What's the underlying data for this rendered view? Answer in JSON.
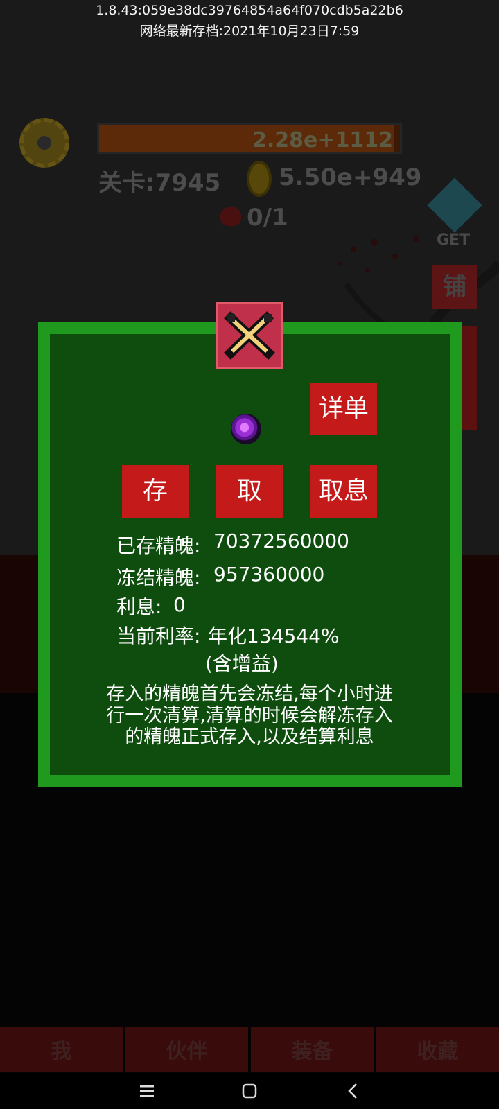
{
  "top": {
    "version": "1.8.43:059e38dc39764854a64f070cdb5a22b6",
    "save_time": "网络最新存档:2021年10月23日7:59"
  },
  "hud": {
    "hp_value": "2.28e+1112",
    "stage": "关卡:7945",
    "gold": "5.50e+949",
    "kills": "0/1",
    "get_label": "GET",
    "shop_label": "铺"
  },
  "dialog": {
    "details_button": "详单",
    "deposit_button": "存",
    "withdraw_button": "取",
    "withdraw_interest_button": "取息",
    "stats": [
      {
        "label": "已存精魄:",
        "value": "70372560000"
      },
      {
        "label": "冻结精魄:",
        "value": "957360000"
      },
      {
        "label": "利息:",
        "value": "0"
      },
      {
        "label": "当前利率:",
        "value": "年化134544%"
      }
    ],
    "rate_note": "(含增益)",
    "description": "存入的精魄首先会冻结,每个小时进行一次清算,清算的时候会解冻存入的精魄正式存入,以及结算利息"
  },
  "bottom_nav": [
    "我",
    "伙伴",
    "装备",
    "收藏"
  ],
  "colors": {
    "dialog_border": "#1f9a1f",
    "dialog_bg": "#0e4d0e",
    "button_red": "#c41a1a",
    "close_bg": "#c0304a"
  },
  "icons": {
    "close": "crossed-swords-close-icon",
    "orb": "purple-spirit-orb-icon",
    "settings": "gear-icon",
    "currency": "gold-coin-icon",
    "enemy": "devil-icon",
    "premium": "diamond-icon"
  }
}
